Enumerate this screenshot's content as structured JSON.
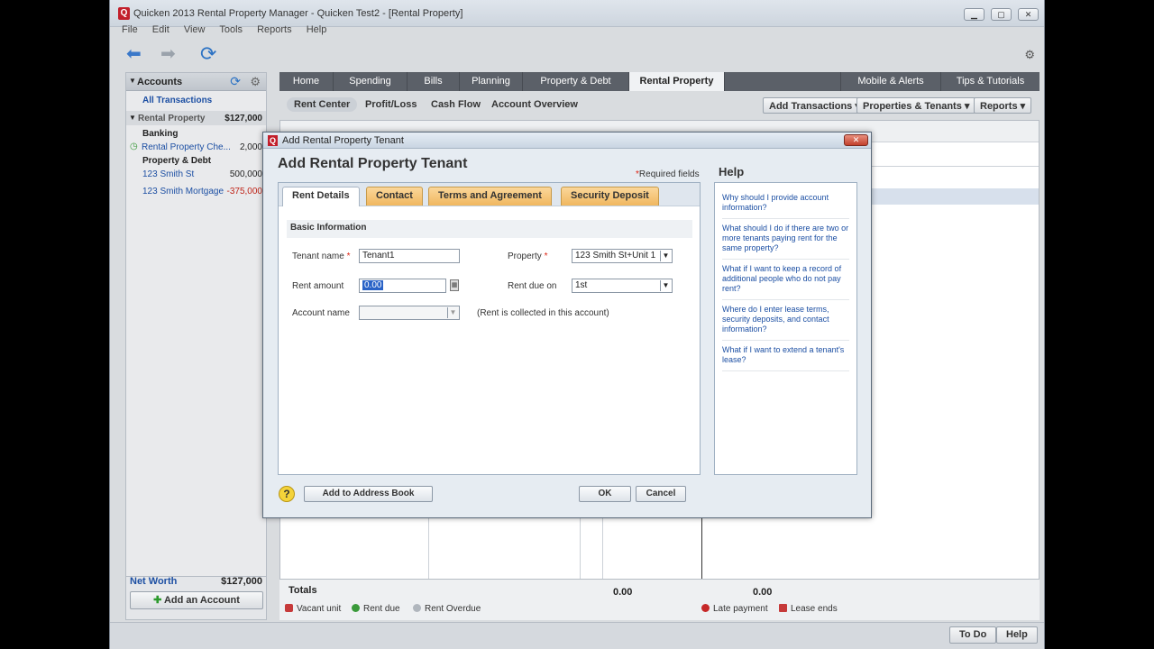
{
  "window": {
    "title": "Quicken 2013 Rental Property Manager - Quicken Test2 - [Rental Property]",
    "logo": "Q",
    "controls": [
      "▁",
      "▢",
      "✕"
    ]
  },
  "menu": [
    "File",
    "Edit",
    "View",
    "Tools",
    "Reports",
    "Help"
  ],
  "sidebar": {
    "header": "Accounts",
    "all_transactions": "All Transactions",
    "group": {
      "label": "Rental Property",
      "amount": "$127,000"
    },
    "banking_label": "Banking",
    "banking_item": {
      "label": "Rental Property Che...",
      "amount": "2,000"
    },
    "property_label": "Property & Debt",
    "items": [
      {
        "label": "123 Smith St",
        "amount": "500,000"
      },
      {
        "label": "123 Smith Mortgage",
        "amount": "-375,000"
      }
    ],
    "net_worth_label": "Net Worth",
    "net_worth_value": "$127,000",
    "add_account": "Add an Account"
  },
  "main_tabs": [
    "Home",
    "Spending",
    "Bills",
    "Planning",
    "Property & Debt",
    "Rental Property",
    "Mobile & Alerts",
    "Tips & Tutorials"
  ],
  "sub_tabs": [
    "Rent Center",
    "Profit/Loss",
    "Cash Flow",
    "Account Overview"
  ],
  "actions": [
    "Add Transactions",
    "Properties & Tenants",
    "Reports"
  ],
  "totals": {
    "label": "Totals",
    "value1": "0.00",
    "value2": "0.00"
  },
  "legend": [
    "Vacant unit",
    "Rent due",
    "Rent Overdue",
    "Late payment",
    "Lease ends"
  ],
  "status_buttons": [
    "To Do",
    "Help"
  ],
  "dialog": {
    "title": "Add Rental Property Tenant",
    "heading": "Add Rental Property Tenant",
    "required_note": "Required fields",
    "tabs": [
      "Rent Details",
      "Contact",
      "Terms and Agreement",
      "Security Deposit"
    ],
    "section": "Basic Information",
    "tenant_name_label": "Tenant name",
    "tenant_name_value": "Tenant1",
    "rent_amount_label": "Rent amount",
    "rent_amount_value": "0.00",
    "account_name_label": "Account name",
    "account_note": "(Rent is collected in this account)",
    "property_label": "Property",
    "property_value": "123 Smith St+Unit 1",
    "rent_due_label": "Rent due on",
    "rent_due_value": "1st",
    "help_title": "Help",
    "help_links": [
      "Why should I provide account information?",
      "What should I do if there are two or more tenants paying rent for the same property?",
      "What if I want to keep a record of additional people who do not pay rent?",
      "Where do I enter lease terms, security deposits, and contact information?",
      "What if I want to extend a tenant's lease?"
    ],
    "add_to_address_book": "Add to Address Book",
    "ok": "OK",
    "cancel": "Cancel"
  },
  "colors": {
    "accent_tab": "#f0b75e",
    "link": "#1c4fa3",
    "required": "#dd2211"
  },
  "icons": [
    "back-arrow-icon",
    "forward-arrow-icon",
    "refresh-icon",
    "gear-icon",
    "help-question-icon"
  ]
}
